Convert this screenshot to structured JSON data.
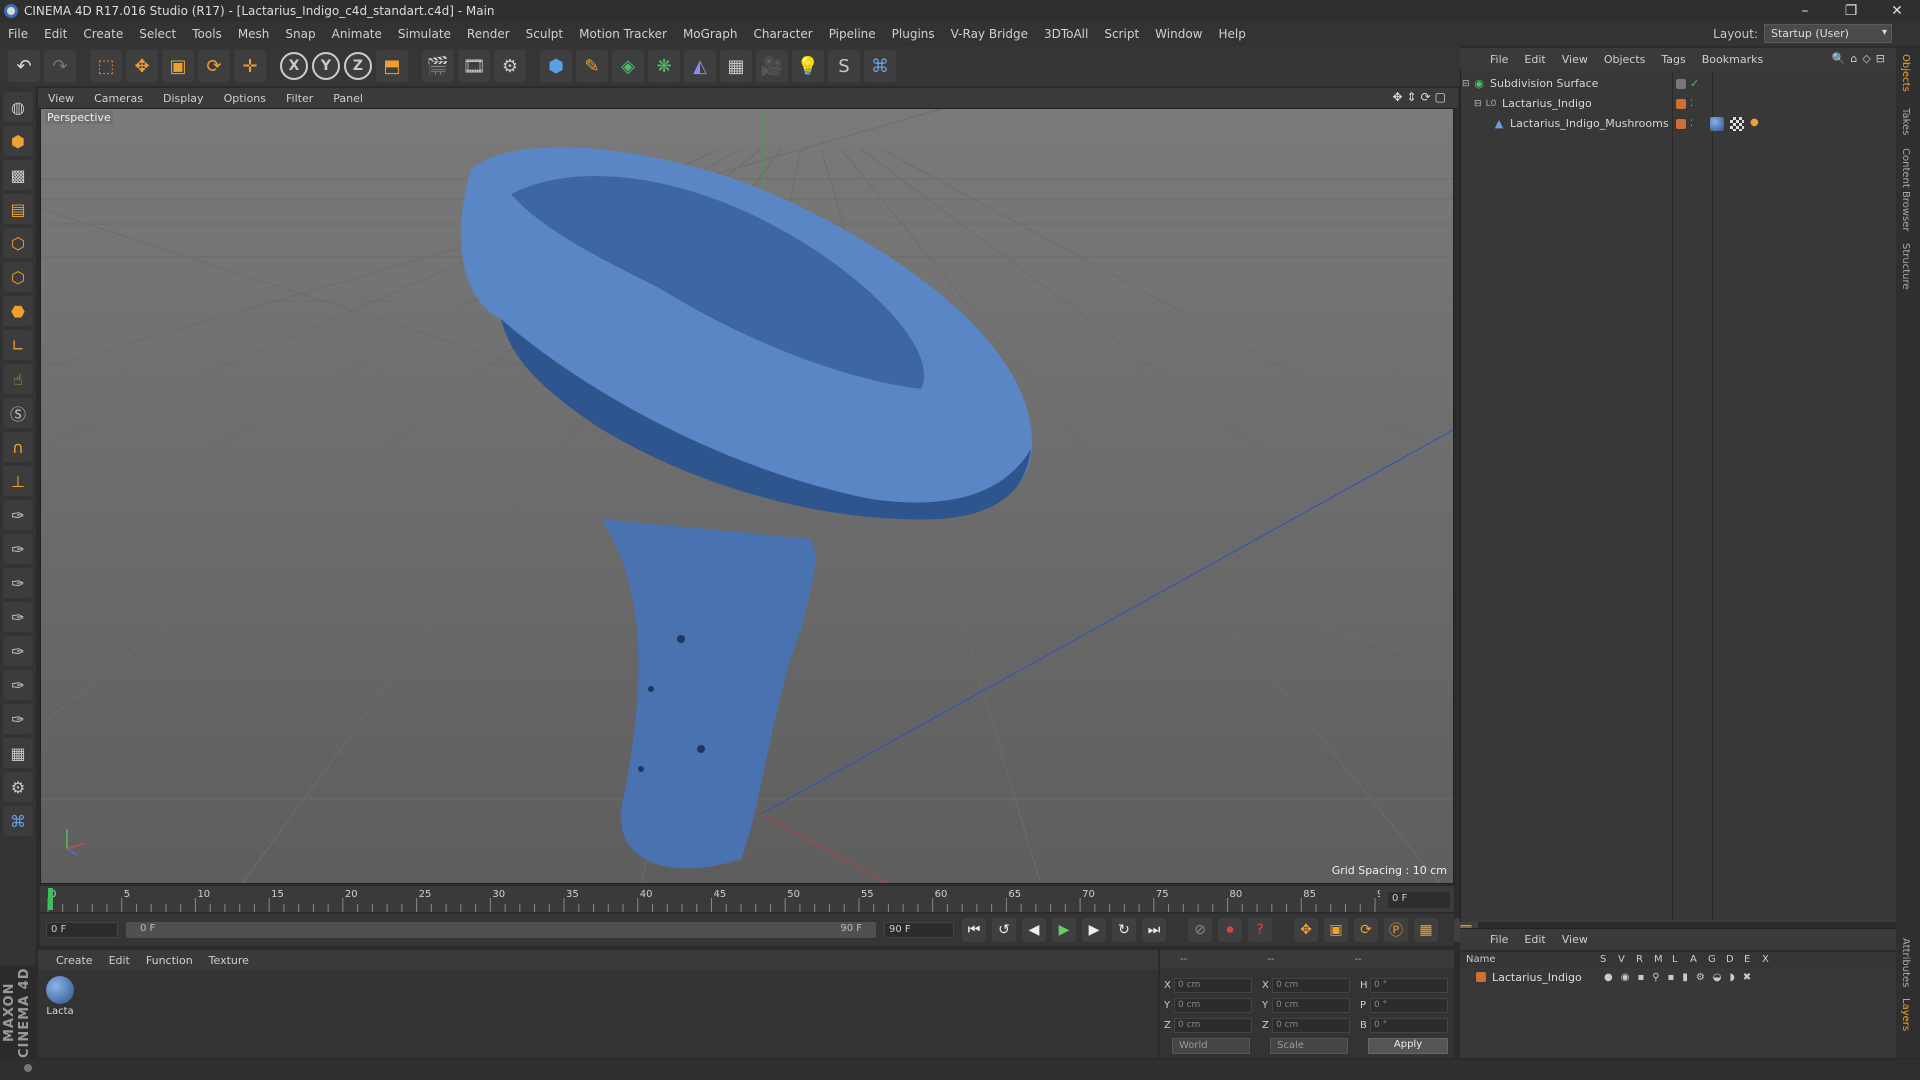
{
  "window": {
    "title": "CINEMA 4D R17.016 Studio (R17) - [Lactarius_Indigo_c4d_standart.c4d] - Main",
    "controls": [
      "–",
      "❐",
      "✕"
    ]
  },
  "menu": [
    "File",
    "Edit",
    "Create",
    "Select",
    "Tools",
    "Mesh",
    "Snap",
    "Animate",
    "Simulate",
    "Render",
    "Sculpt",
    "Motion Tracker",
    "MoGraph",
    "Character",
    "Pipeline",
    "Plugins",
    "V-Ray Bridge",
    "3DToAll",
    "Script",
    "Window",
    "Help"
  ],
  "layout": {
    "label": "Layout:",
    "value": "Startup (User)"
  },
  "toolbar": {
    "undo": "↶",
    "redo": "↷",
    "axis_x": "X",
    "axis_y": "Y",
    "axis_z": "Z"
  },
  "viewport": {
    "menu": [
      "View",
      "Cameras",
      "Display",
      "Options",
      "Filter",
      "Panel"
    ],
    "camera_label": "Perspective",
    "grid_spacing": "Grid Spacing : 10 cm",
    "nav_icons": "✥⇕⟳▢"
  },
  "timeline": {
    "start": 0,
    "end": 90,
    "step": 5,
    "current_frame": "0 F"
  },
  "transport": {
    "field_start": "0 F",
    "slider_start": "0 F",
    "slider_end": "90 F",
    "field_end": "90 F",
    "buttons": [
      "⏮",
      "↺",
      "◀",
      "▶",
      "▶",
      "↻",
      "⏭"
    ]
  },
  "materials": {
    "menu": [
      "Create",
      "Edit",
      "Function",
      "Texture"
    ],
    "items": [
      {
        "name": "Lacta"
      }
    ]
  },
  "coordinates": {
    "header": [
      "--",
      "--",
      "--"
    ],
    "rows": [
      {
        "a": "X",
        "av": "0 cm",
        "b": "X",
        "bv": "0 cm",
        "c": "H",
        "cv": "0 °"
      },
      {
        "a": "Y",
        "av": "0 cm",
        "b": "Y",
        "bv": "0 cm",
        "c": "P",
        "cv": "0 °"
      },
      {
        "a": "Z",
        "av": "0 cm",
        "b": "Z",
        "bv": "0 cm",
        "c": "B",
        "cv": "0 °"
      }
    ],
    "space": "World",
    "mode": "Scale",
    "apply": "Apply"
  },
  "objects": {
    "menu": [
      "File",
      "Edit",
      "View",
      "Objects",
      "Tags",
      "Bookmarks"
    ],
    "tools": "🔍⌂◇⊟",
    "items": [
      {
        "name": "Subdivision Surface",
        "indent": 0,
        "icon": "◉",
        "color": "#4fbf6a"
      },
      {
        "name": "Lactarius_Indigo",
        "indent": 1,
        "icon": "L0",
        "color": "#d07030"
      },
      {
        "name": "Lactarius_Indigo_Mushrooms",
        "indent": 2,
        "icon": "▲",
        "color": "#d07030"
      }
    ],
    "check": "✓"
  },
  "layers": {
    "menu": [
      "File",
      "Edit",
      "View"
    ],
    "columns": [
      "Name",
      "S",
      "V",
      "R",
      "M",
      "L",
      "A",
      "G",
      "D",
      "E",
      "X"
    ],
    "items": [
      {
        "name": "Lactarius_Indigo",
        "color": "#d07030"
      }
    ]
  },
  "side_tabs": [
    "Objects",
    "Takes",
    "Content Browser",
    "Structure",
    "Attributes",
    "Layers"
  ],
  "branding": "MAXON CINEMA 4D",
  "colors": {
    "accent": "#f0a030",
    "mushroom": "#4a78c0",
    "grid": "#6c6c6c"
  }
}
